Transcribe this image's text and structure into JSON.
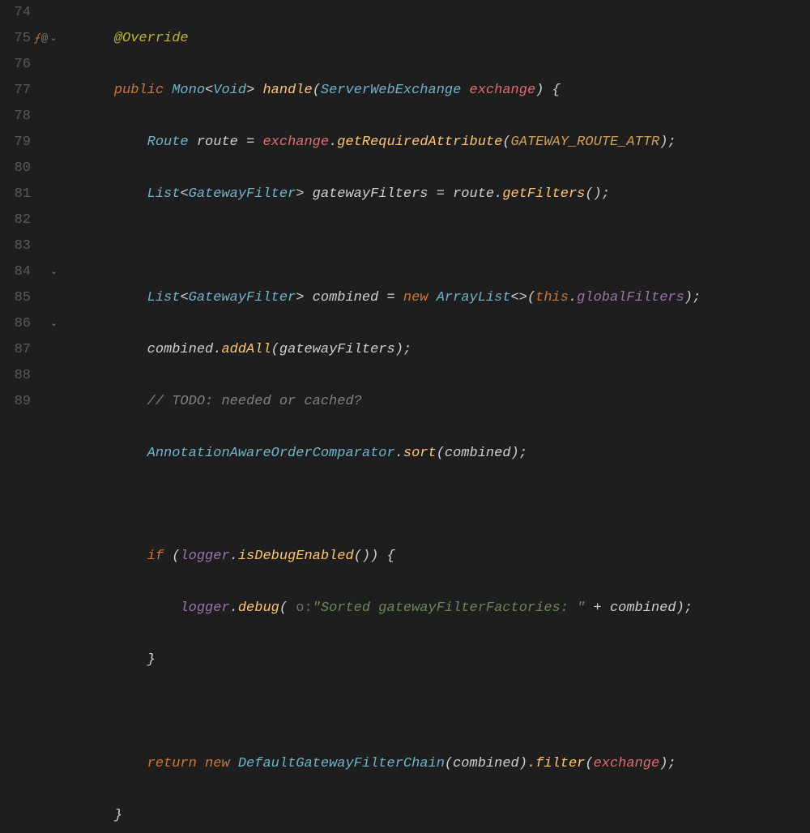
{
  "gutter": {
    "lines": [
      "74",
      "75",
      "76",
      "77",
      "78",
      "79",
      "80",
      "81",
      "82",
      "83",
      "84",
      "85",
      "86",
      "87",
      "88",
      "89"
    ],
    "impl_icon": "⨍",
    "at_icon": "@",
    "fold_open": "⌄"
  },
  "code": {
    "l74": {
      "ann": "@Override"
    },
    "l75": {
      "kw_public": "public",
      "type_mono": "Mono",
      "type_void": "Void",
      "method": "handle",
      "type_param": "ServerWebExchange",
      "param": "exchange",
      "brace": "{"
    },
    "l76": {
      "type": "Route",
      "var": "route",
      "op": "=",
      "param": "exchange",
      "dot": ".",
      "method": "getRequiredAttribute",
      "const": "GATEWAY_ROUTE_ATTR",
      "semi": ";"
    },
    "l77": {
      "type_list": "List",
      "type_gf": "GatewayFilter",
      "var": "gatewayFilters",
      "op": "=",
      "obj": "route",
      "dot": ".",
      "method": "getFilters",
      "semi": ";"
    },
    "l79": {
      "type_list": "List",
      "type_gf": "GatewayFilter",
      "var": "combined",
      "op": "=",
      "kw_new": "new",
      "type_al": "ArrayList",
      "diamond": "<>",
      "kw_this": "this",
      "dot": ".",
      "field": "globalFilters",
      "semi": ";"
    },
    "l80": {
      "obj": "combined",
      "dot": ".",
      "method": "addAll",
      "arg": "gatewayFilters",
      "semi": ";"
    },
    "l81": {
      "comment": "// TODO: needed or cached?"
    },
    "l82": {
      "type": "AnnotationAwareOrderComparator",
      "dot": ".",
      "method": "sort",
      "arg": "combined",
      "semi": ";"
    },
    "l84": {
      "kw_if": "if",
      "obj": "logger",
      "dot": ".",
      "method": "isDebugEnabled",
      "brace": "{"
    },
    "l85": {
      "obj": "logger",
      "dot": ".",
      "method": "debug",
      "hint": "o:",
      "str": "\"Sorted gatewayFilterFactories: \"",
      "plus": "+",
      "arg": "combined",
      "semi": ";"
    },
    "l86": {
      "brace": "}"
    },
    "l88": {
      "kw_return": "return",
      "kw_new": "new",
      "type": "DefaultGatewayFilterChain",
      "arg1": "combined",
      "dot": ".",
      "method": "filter",
      "arg2": "exchange",
      "semi": ";"
    },
    "l89": {
      "brace": "}"
    }
  }
}
